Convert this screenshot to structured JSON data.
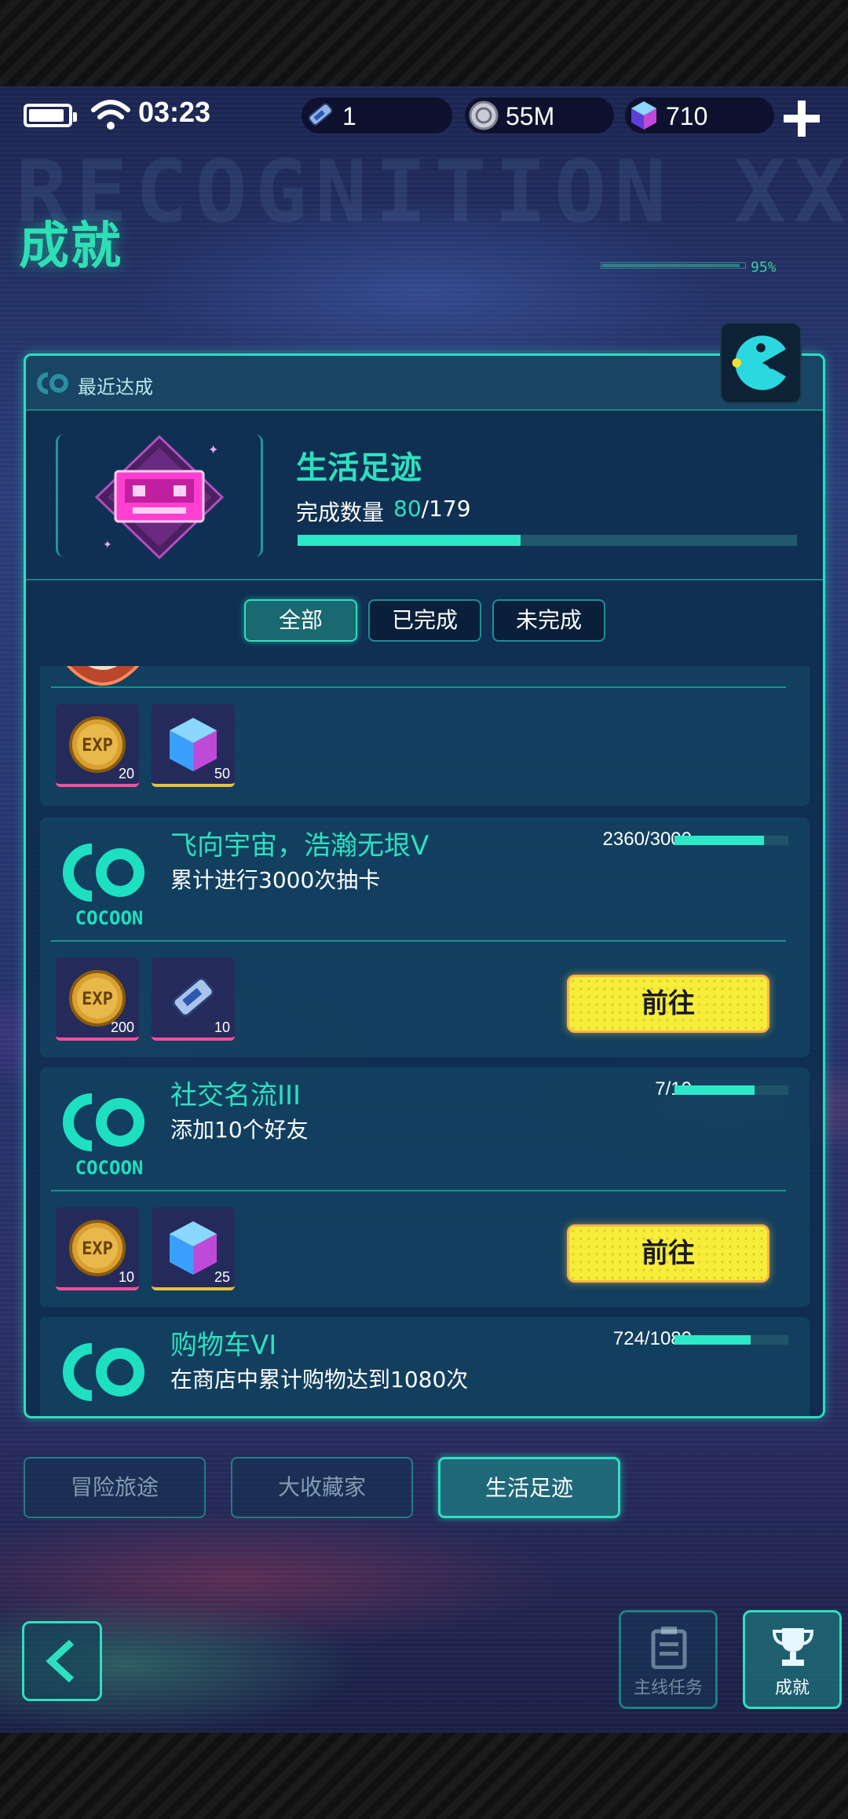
{
  "status_bar": {
    "time": "03:23",
    "tickets": "1",
    "coins": "55M",
    "gems": "710"
  },
  "header": {
    "title": "成就",
    "background_text": "RECOGNITION XXX",
    "deco_percent": "95%"
  },
  "recent": {
    "section_label": "最近达成",
    "name": "生活足迹",
    "count_label": "完成数量",
    "count_done": "80",
    "count_total": "/179",
    "progress": 0.447
  },
  "filters": [
    {
      "label": "全部",
      "active": true
    },
    {
      "label": "已完成",
      "active": false
    },
    {
      "label": "未完成",
      "active": false
    }
  ],
  "achievements": [
    {
      "title": "",
      "desc": "",
      "progress_text": "",
      "rewards": [
        {
          "icon": "exp-coin-icon",
          "qty": "20",
          "rarity": "pink"
        },
        {
          "icon": "cube-gem-icon",
          "qty": "50",
          "rarity": "gold"
        }
      ]
    },
    {
      "title": "飞向宇宙，浩瀚无垠V",
      "desc": "累计进行3000次抽卡",
      "progress_text": "2360/3000",
      "progress": 0.787,
      "logo_text": "COCOON",
      "button": "前往",
      "rewards": [
        {
          "icon": "exp-coin-icon",
          "qty": "200",
          "rarity": "pink"
        },
        {
          "icon": "ticket-icon",
          "qty": "10",
          "rarity": "pink"
        }
      ]
    },
    {
      "title": "社交名流III",
      "desc": "添加10个好友",
      "progress_text": "7/10",
      "progress": 0.7,
      "logo_text": "COCOON",
      "button": "前往",
      "rewards": [
        {
          "icon": "exp-coin-icon",
          "qty": "10",
          "rarity": "pink"
        },
        {
          "icon": "cube-gem-icon",
          "qty": "25",
          "rarity": "gold"
        }
      ]
    },
    {
      "title": "购物车VI",
      "desc": "在商店中累计购物达到1080次",
      "progress_text": "724/1080",
      "progress": 0.67
    }
  ],
  "categories": [
    {
      "label": "冒险旅途",
      "active": false
    },
    {
      "label": "大收藏家",
      "active": false
    },
    {
      "label": "生活足迹",
      "active": true
    }
  ],
  "bottom_nav": {
    "main_quest_label": "主线任务",
    "achievement_label": "成就"
  },
  "colors": {
    "accent": "#2de0c0",
    "button_yellow": "#f8ee3a",
    "panel_border": "#29e0c0"
  }
}
